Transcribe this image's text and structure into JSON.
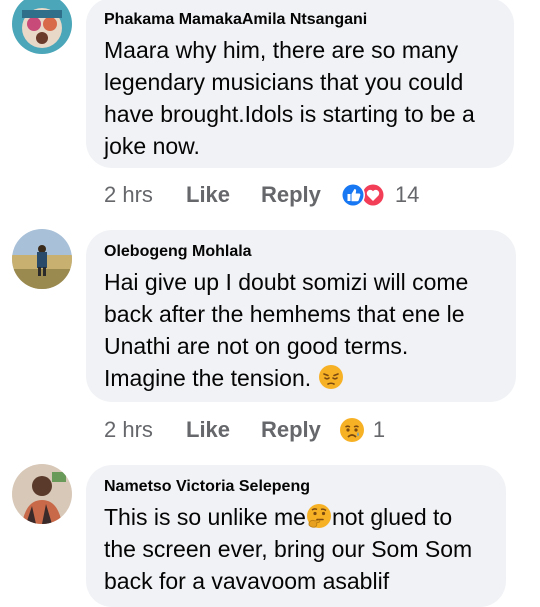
{
  "comments": [
    {
      "author": "Phakama MamakaAmila Ntsangani",
      "text": "Maara why him, there are so many\nlegendary musicians that you could\nhave brought.Idols is starting to be a\njoke now.",
      "time": "2 hrs",
      "like_label": "Like",
      "reply_label": "Reply",
      "reactions": [
        "like",
        "love"
      ],
      "reaction_count": "14"
    },
    {
      "author": "Olebogeng Mohlala",
      "text": "Hai give up  I doubt somizi will come\nback after the hemhems that ene le\nUnathi are not on good terms.\nImagine the tension. ",
      "inline_emoji": "pensive-face",
      "time": "2 hrs",
      "like_label": "Like",
      "reply_label": "Reply",
      "reactions": [
        "sad"
      ],
      "reaction_count": "1"
    },
    {
      "author": "Nametso Victoria Selepeng",
      "text_part1": "This is so unlike me",
      "inline_emoji": "thinking-face",
      "text_part2": "not glued to\nthe screen ever, bring our Som Som\nback for a vavavoom asablif"
    }
  ],
  "colors": {
    "bubble": "#f0f2f5",
    "meta": "#65676b",
    "like_blue": "#1877f2",
    "love_red": "#f33e58",
    "emoji_yellow": "#f7b125"
  }
}
